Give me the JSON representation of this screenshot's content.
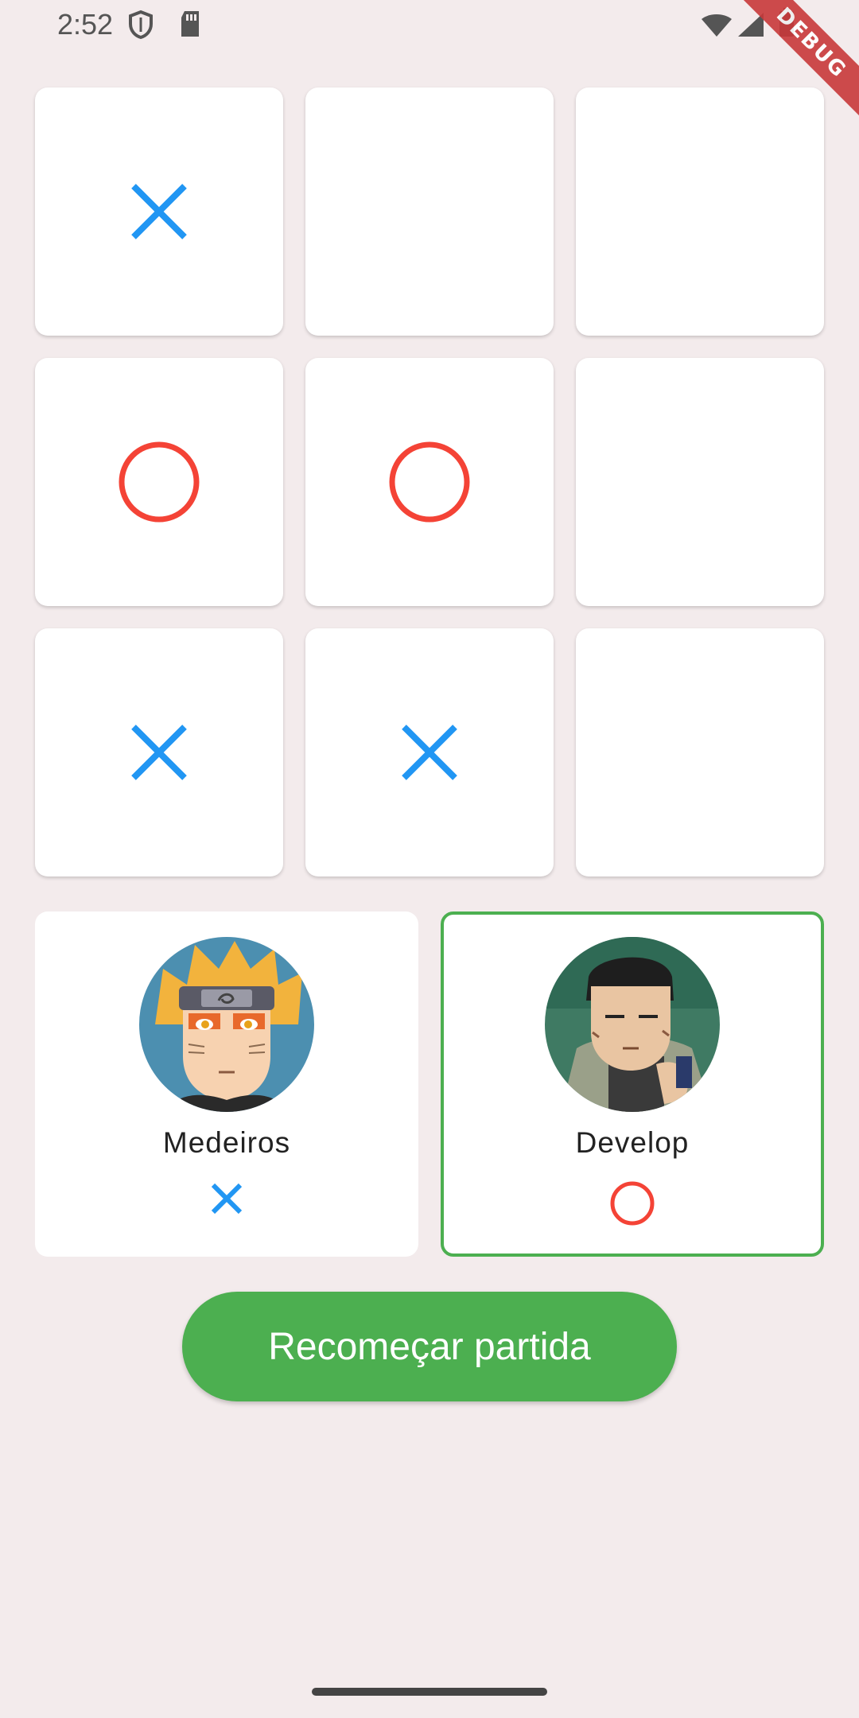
{
  "status_bar": {
    "time": "2:52",
    "icons_left": [
      "shield-icon",
      "sd-card-icon"
    ],
    "icons_right": [
      "wifi-icon",
      "signal-icon",
      "battery-icon"
    ]
  },
  "debug_banner": "DEBUG",
  "board": {
    "cells": [
      "X",
      "",
      "",
      "O",
      "O",
      "",
      "X",
      "X",
      ""
    ],
    "colors": {
      "x": "#2196F3",
      "o": "#F44336"
    }
  },
  "players": [
    {
      "name": "Medeiros",
      "mark": "X",
      "active": false
    },
    {
      "name": "Develop",
      "mark": "O",
      "active": true
    }
  ],
  "restart_button": "Recomeçar partida",
  "colors": {
    "background": "#F3EBEC",
    "card": "#FFFFFF",
    "accent": "#4CAF50"
  }
}
